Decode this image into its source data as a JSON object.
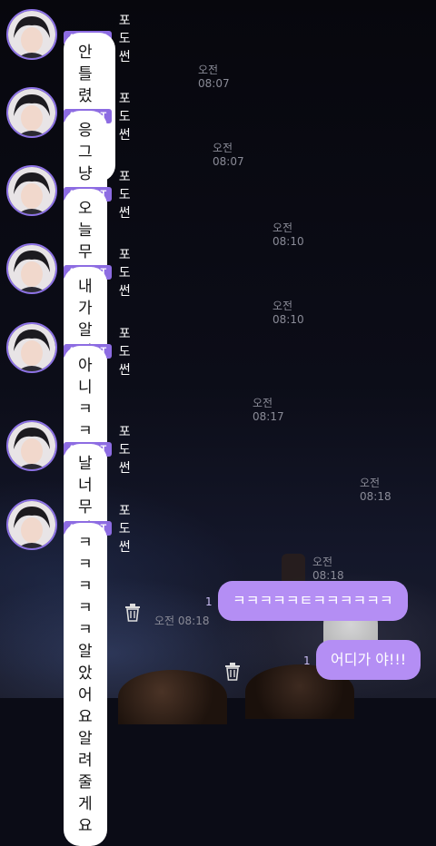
{
  "artist": {
    "badge": "ARTIST",
    "name": "포도썬"
  },
  "incoming": [
    {
      "text": "안틀렸다구요?",
      "time": "오전 08:07"
    },
    {
      "text": "응 그냥 틀렸구요",
      "time": "오전 08:07"
    },
    {
      "text": "오늘 무대의상이 뭐냐면요",
      "time": "오전 08:10"
    },
    {
      "text": "내가 알려줄게요 뭐냐면요",
      "time": "오전 08:10"
    },
    {
      "text": "아니 ㅋㅋㅋㅋㅋ진심\n안알려주고 자려했는데",
      "time": "오전 08:17"
    },
    {
      "text": "날 너무 잘알아서 너무 웃기다 ㅋㅋㅋㅋ",
      "time": "오전 08:18"
    },
    {
      "text": "ㅋㅋㅋㅋㅋ알았어요 알려줄게요",
      "time": "오전 08:18"
    }
  ],
  "outgoing": [
    {
      "text": "ㅋㅋㅋㅋㅋㅌㅋㅋㅋㅋㅋㅋ",
      "unread": "1",
      "time": "오전 08:18"
    },
    {
      "text": "어디가 야!!!",
      "unread": "1"
    }
  ],
  "colors": {
    "badge": "#8d6ce2",
    "outgoing_bubble": "#b48ef4",
    "avatar_ring": "#8d72e6"
  }
}
